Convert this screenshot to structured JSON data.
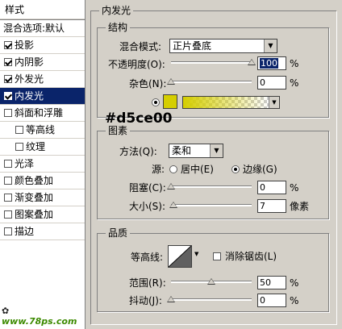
{
  "styles_panel": {
    "title": "样式",
    "blend_options": "混合选项:默认",
    "items": [
      {
        "label": "投影",
        "checked": true,
        "sub": false
      },
      {
        "label": "内阴影",
        "checked": true,
        "sub": false
      },
      {
        "label": "外发光",
        "checked": true,
        "sub": false
      },
      {
        "label": "内发光",
        "checked": true,
        "sub": false,
        "selected": true
      },
      {
        "label": "斜面和浮雕",
        "checked": false,
        "sub": false
      },
      {
        "label": "等高线",
        "checked": false,
        "sub": true
      },
      {
        "label": "纹理",
        "checked": false,
        "sub": true
      },
      {
        "label": "光泽",
        "checked": false,
        "sub": false
      },
      {
        "label": "颜色叠加",
        "checked": false,
        "sub": false
      },
      {
        "label": "渐变叠加",
        "checked": false,
        "sub": false
      },
      {
        "label": "图案叠加",
        "checked": false,
        "sub": false
      },
      {
        "label": "描边",
        "checked": false,
        "sub": false
      }
    ]
  },
  "inner_glow": {
    "title": "内发光",
    "structure": {
      "title": "结构",
      "blend_mode_label": "混合模式:",
      "blend_mode_value": "正片叠底",
      "opacity_label": "不透明度(O):",
      "opacity_value": "100",
      "opacity_fraction": 1.0,
      "noise_label": "杂色(N):",
      "noise_value": "0",
      "noise_fraction": 0.0,
      "percent": "%",
      "color_hex": "#d5ce00",
      "color_annotation": "#d5ce00"
    },
    "elements": {
      "title": "图素",
      "technique_label": "方法(Q):",
      "technique_value": "柔和",
      "source_label": "源:",
      "source_center": "居中(E)",
      "source_edge": "边缘(G)",
      "source_selected": "edge",
      "choke_label": "阻塞(C):",
      "choke_value": "0",
      "choke_fraction": 0.0,
      "size_label": "大小(S):",
      "size_value": "7",
      "size_fraction": 0.03,
      "size_unit": "像素",
      "percent": "%"
    },
    "quality": {
      "title": "品质",
      "contour_label": "等高线:",
      "anti_alias_label": "消除锯齿(L)",
      "anti_alias_checked": false,
      "range_label": "范围(R):",
      "range_value": "50",
      "range_fraction": 0.5,
      "jitter_label": "抖动(J):",
      "jitter_value": "0",
      "jitter_fraction": 0.0,
      "percent": "%"
    }
  },
  "watermark": "www.78ps.com"
}
